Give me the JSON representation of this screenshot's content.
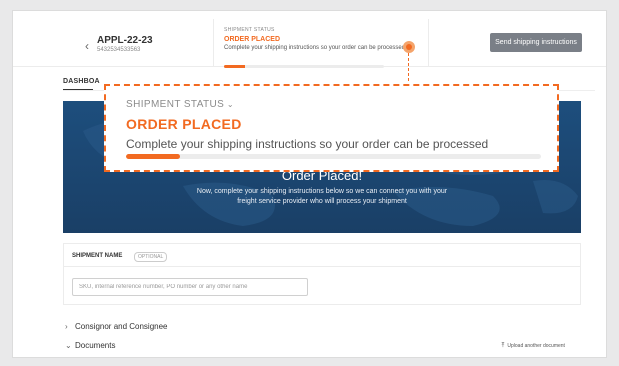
{
  "header": {
    "back_icon": "chevron-left-icon",
    "reference": "APPL-22-23",
    "reference_sub": "5432534533563",
    "send_button": "Send shipping instructions"
  },
  "status": {
    "label": "SHIPMENT STATUS",
    "title": "ORDER PLACED",
    "text": "Complete your shipping instructions so your order can be processed",
    "progress": 0.13,
    "accent_color": "#f26a21"
  },
  "tabs": {
    "active": "DASHBOA"
  },
  "banner": {
    "title": "Order Placed!",
    "text": "Now, complete your shipping instructions below so we can connect you with your freight service provider who will process your shipment"
  },
  "shipment_name": {
    "label": "SHIPMENT NAME",
    "optional": "OPTIONAL",
    "placeholder": "SKU, internal reference number, PO number or any other name"
  },
  "sections": {
    "consignor": "Consignor and Consignee",
    "documents": "Documents",
    "upload": "Upload another document"
  },
  "zoom": {
    "label": "SHIPMENT STATUS",
    "title": "ORDER PLACED",
    "text": "Complete your shipping instructions so your order can be processed",
    "progress": 0.13
  }
}
